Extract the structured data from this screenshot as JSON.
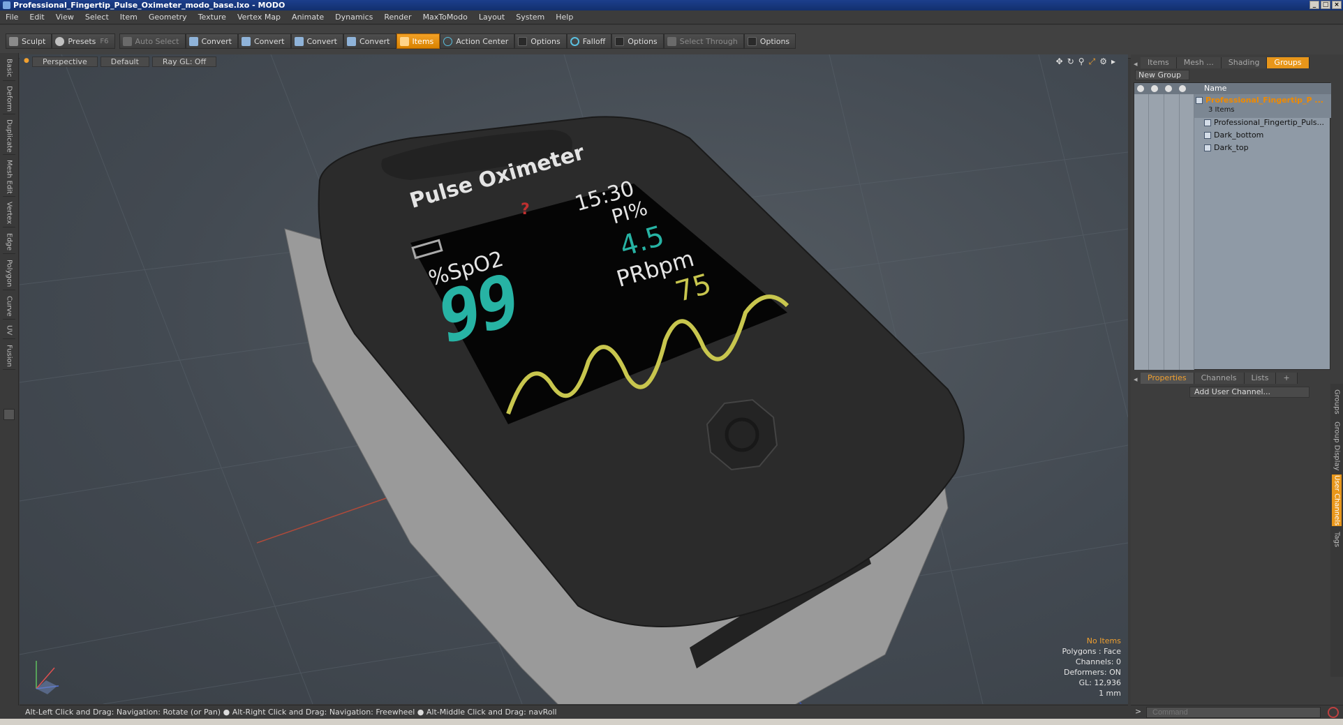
{
  "window": {
    "title": "Professional_Fingertip_Pulse_Oximeter_modo_base.lxo - MODO",
    "buttons": [
      "_",
      "□",
      "×"
    ]
  },
  "menu": [
    "File",
    "Edit",
    "View",
    "Select",
    "Item",
    "Geometry",
    "Texture",
    "Vertex Map",
    "Animate",
    "Dynamics",
    "Render",
    "MaxToModo",
    "Layout",
    "System",
    "Help"
  ],
  "toolbar": {
    "sculpt": "Sculpt",
    "presets": "Presets",
    "presets_key": "F6",
    "auto_select": "Auto Select",
    "convert1": "Convert",
    "convert2": "Convert",
    "convert3": "Convert",
    "convert4": "Convert",
    "items": "Items",
    "action_center": "Action Center",
    "options1": "Options",
    "falloff": "Falloff",
    "options2": "Options",
    "select_through": "Select Through",
    "options3": "Options"
  },
  "left_tabs": [
    "Basic",
    "Deform",
    "Duplicate",
    "Mesh Edit",
    "Vertex",
    "Edge",
    "Polygon",
    "Curve",
    "UV",
    "Fusion"
  ],
  "viewport": {
    "view": "Perspective",
    "shading": "Default",
    "raygl": "Ray GL: Off",
    "model": {
      "brand": "Pulse Oximeter",
      "time": "15:30",
      "question": "?",
      "spo2_label": "%SpO2",
      "spo2_value": "99",
      "pi_label": "PI%",
      "pi_value": "4.5",
      "pr_label": "PRbpm",
      "pr_value": "75"
    },
    "stats": {
      "selection": "No Items",
      "polygons": "Polygons : Face",
      "channels": "Channels: 0",
      "deformers": "Deformers: ON",
      "gl": "GL: 12,936",
      "unit": "1 mm"
    }
  },
  "status": "Alt-Left Click and Drag: Navigation: Rotate (or Pan) ● Alt-Right Click and Drag: Navigation: Freewheel ● Alt-Middle Click and Drag: navRoll",
  "right_panel": {
    "tabs": [
      "Items",
      "Mesh ...",
      "Shading",
      "Groups"
    ],
    "new_group": "New Group",
    "column_name": "Name",
    "group_name": "Professional_Fingertip_P ...",
    "group_count": "3 Items",
    "children": [
      "Professional_Fingertip_Puls...",
      "Dark_bottom",
      "Dark_top"
    ],
    "bottom_tabs": [
      "Properties",
      "Channels",
      "Lists",
      "+"
    ],
    "add_user_channel": "Add User Channel...",
    "side_tabs": [
      "Groups",
      "Group Display",
      "User Channels",
      "Tags"
    ],
    "command_placeholder": "Command"
  },
  "colors": {
    "accent": "#e8961a",
    "screen_teal": "#27b3a4",
    "screen_wave": "#c8c64e"
  }
}
